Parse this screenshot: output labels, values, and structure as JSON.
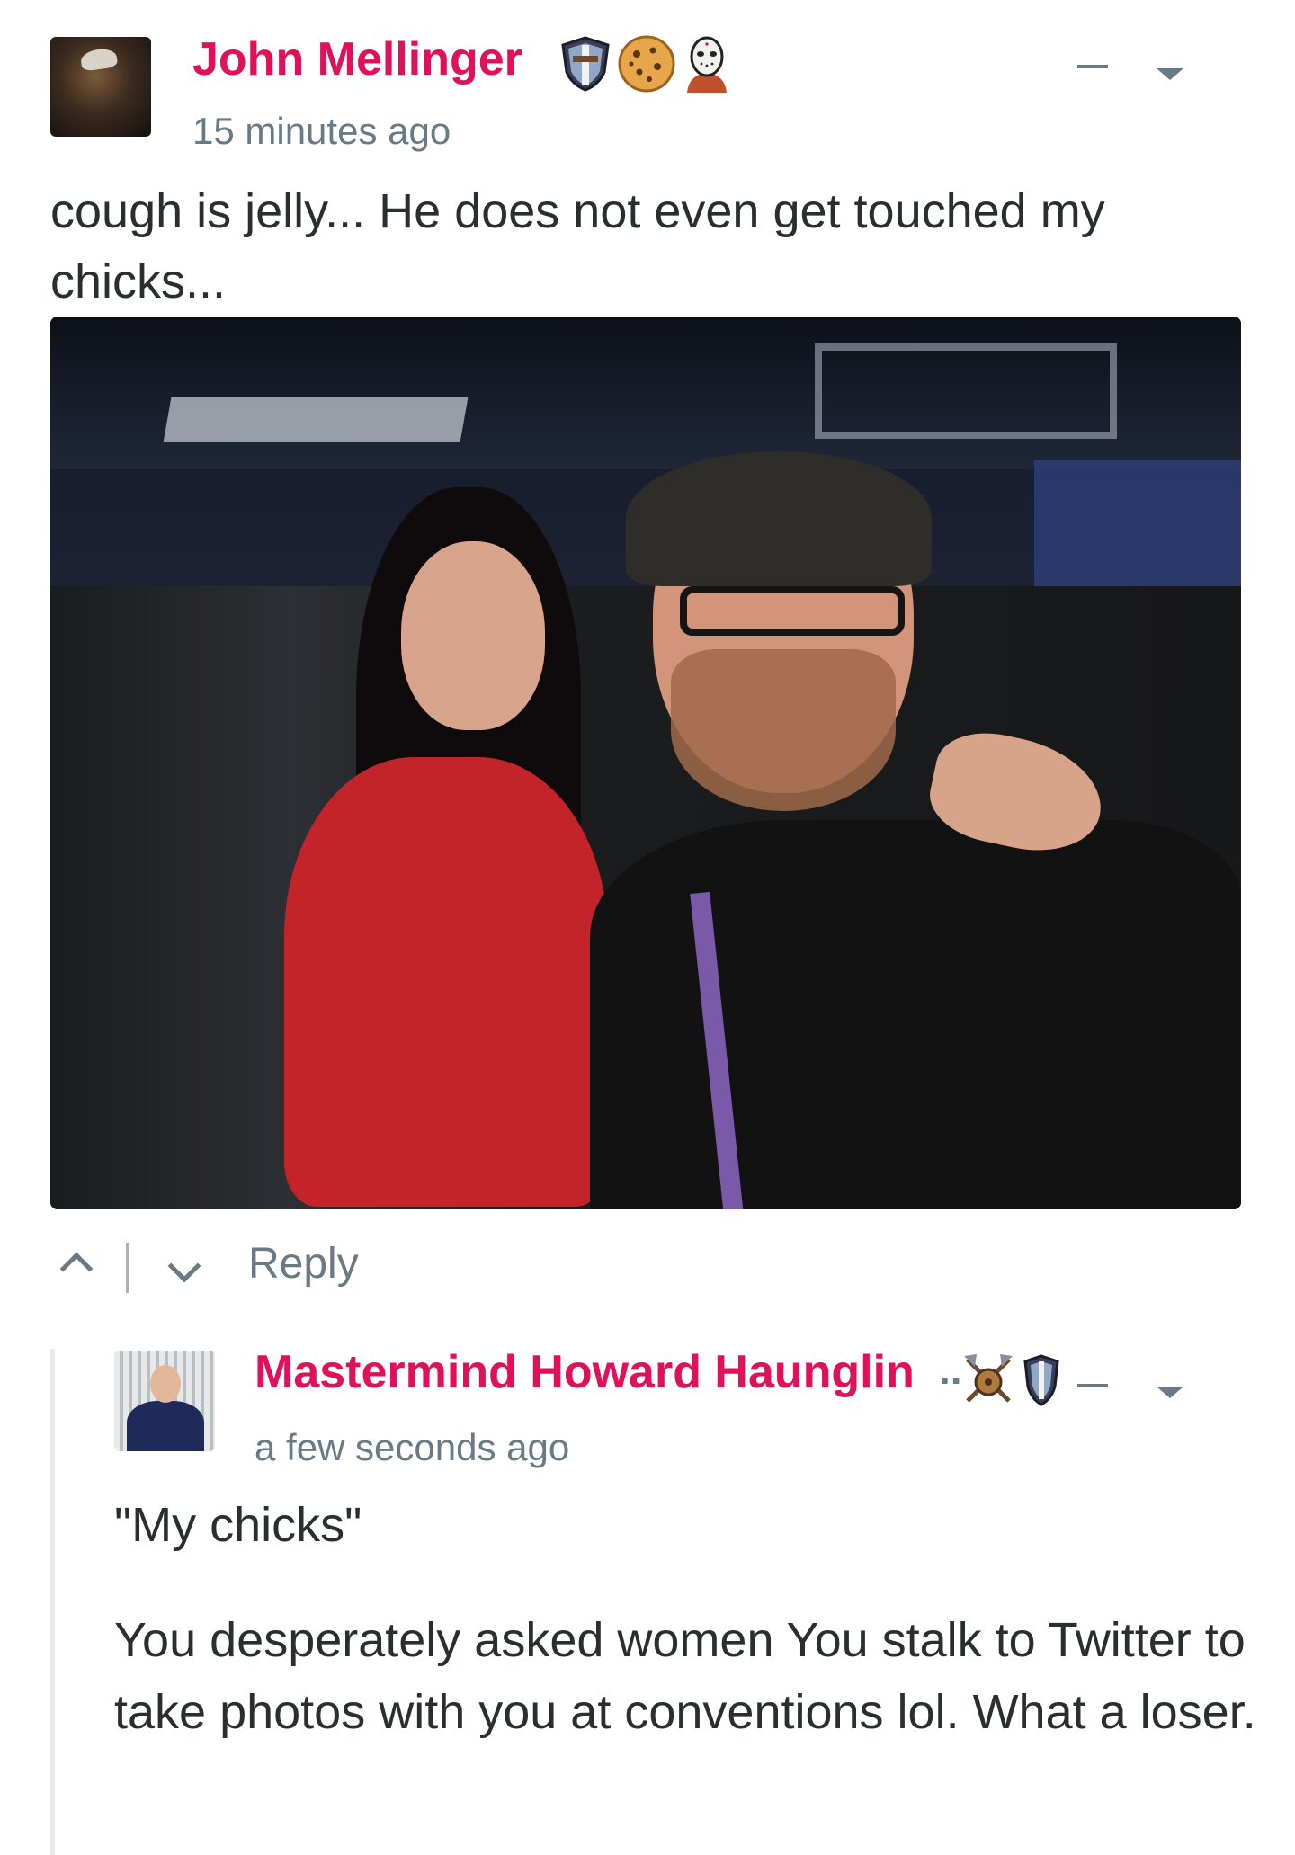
{
  "comment": {
    "author": "John Mellinger",
    "timestamp": "15 minutes ago",
    "badges": [
      "shield-badge-icon",
      "cookie-badge-icon",
      "hockey-mask-badge-icon"
    ],
    "text": "cough is jelly... He does not even get touched my chicks...",
    "photo": "selfie-photo",
    "actions": {
      "upvote": "chevron-up-icon",
      "downvote": "chevron-down-icon",
      "reply": "Reply"
    }
  },
  "reply": {
    "author": "Mastermind Howard Haunglin",
    "truncation": "..",
    "timestamp": "a few seconds ago",
    "badges": [
      "crossed-axes-badge-icon",
      "shield-badge-icon"
    ],
    "paragraphs": [
      "\"My chicks\"",
      "You desperately asked women You stalk to Twitter to take photos with you at conventions lol. What a loser."
    ]
  },
  "colors": {
    "author": "#e0105a",
    "meta": "#687a86",
    "text": "#2a2e2e",
    "thread_line": "#e7e9ee"
  }
}
